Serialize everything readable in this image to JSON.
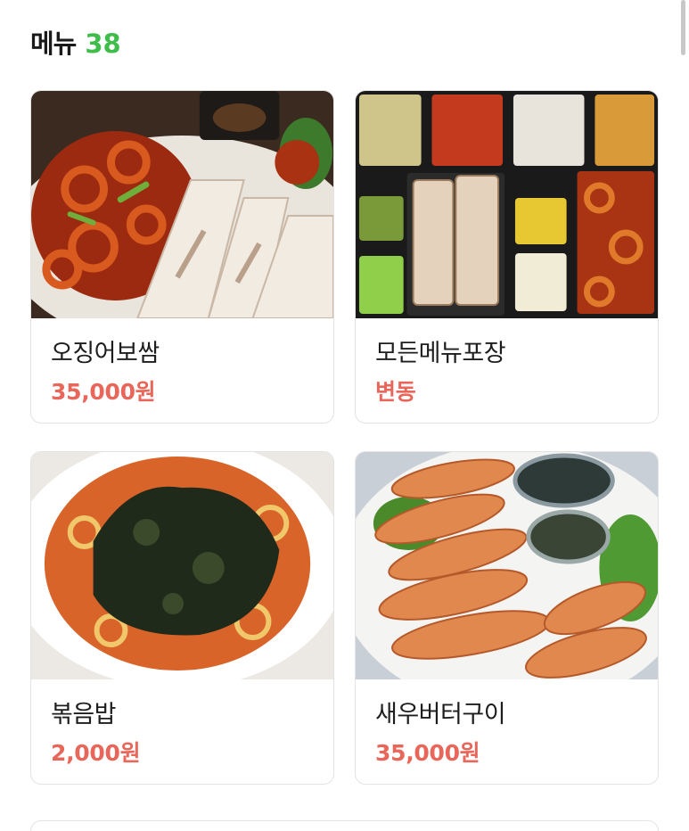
{
  "header": {
    "title": "메뉴",
    "count": "38"
  },
  "colors": {
    "accent_green": "#3fbd4a",
    "price_red": "#e8675a"
  },
  "menu": [
    {
      "name": "오징어보쌈",
      "price": "35,000원",
      "image": "squid-bossam-photo"
    },
    {
      "name": "모든메뉴포장",
      "price": "변동",
      "image": "takeout-box-photo"
    },
    {
      "name": "볶음밥",
      "price": "2,000원",
      "image": "fried-rice-photo"
    },
    {
      "name": "새우버터구이",
      "price": "35,000원",
      "image": "butter-shrimp-photo"
    }
  ]
}
